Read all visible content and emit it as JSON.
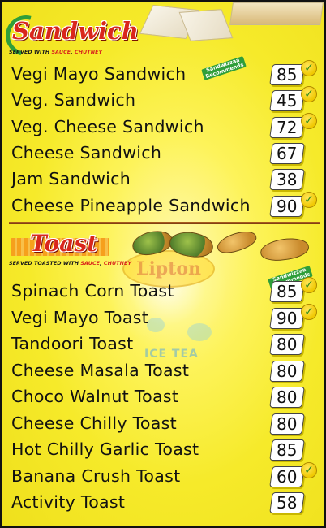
{
  "sandwich": {
    "title": "Sandwich",
    "subtitle_prefix": "SERVED WITH ",
    "subtitle_sauce": "SAUCE",
    "subtitle_mid": ", ",
    "subtitle_chutney": "CHUTNEY",
    "recommend_line1": "Sandwizzaa",
    "recommend_line2": "Recommends",
    "items": [
      {
        "name": "Vegi Mayo Sandwich",
        "price": "85",
        "recommended": true
      },
      {
        "name": "Veg. Sandwich",
        "price": "45",
        "recommended": true
      },
      {
        "name": "Veg. Cheese Sandwich",
        "price": "72",
        "recommended": true
      },
      {
        "name": "Cheese Sandwich",
        "price": "67",
        "recommended": false
      },
      {
        "name": "Jam Sandwich",
        "price": "38",
        "recommended": false
      },
      {
        "name": "Cheese Pineapple Sandwich",
        "price": "90",
        "recommended": true
      }
    ]
  },
  "toast": {
    "title": "Toast",
    "subtitle_prefix": "SERVED TOASTED WITH ",
    "subtitle_sauce": "SAUCE",
    "subtitle_mid": ", ",
    "subtitle_chutney": "CHUTNEY",
    "recommend_line1": "Sandwizzaa",
    "recommend_line2": "Recommends",
    "items": [
      {
        "name": "Spinach Corn Toast",
        "price": "85",
        "recommended": true
      },
      {
        "name": "Vegi Mayo Toast",
        "price": "90",
        "recommended": true
      },
      {
        "name": "Tandoori Toast",
        "price": "80",
        "recommended": false
      },
      {
        "name": "Cheese Masala Toast",
        "price": "80",
        "recommended": false
      },
      {
        "name": "Choco Walnut Toast",
        "price": "80",
        "recommended": false
      },
      {
        "name": "Cheese Chilly Toast",
        "price": "80",
        "recommended": false
      },
      {
        "name": "Hot Chilly Garlic Toast",
        "price": "85",
        "recommended": false
      },
      {
        "name": "Banana Crush Toast",
        "price": "60",
        "recommended": true
      },
      {
        "name": "Activity Toast",
        "price": "58",
        "recommended": false
      }
    ]
  },
  "watermark": {
    "brand": "Lipton",
    "caption": "ICE TEA"
  },
  "colors": {
    "background": "#f6ea2a",
    "title_red": "#d9261c",
    "accent_green": "#2f9e3a"
  }
}
